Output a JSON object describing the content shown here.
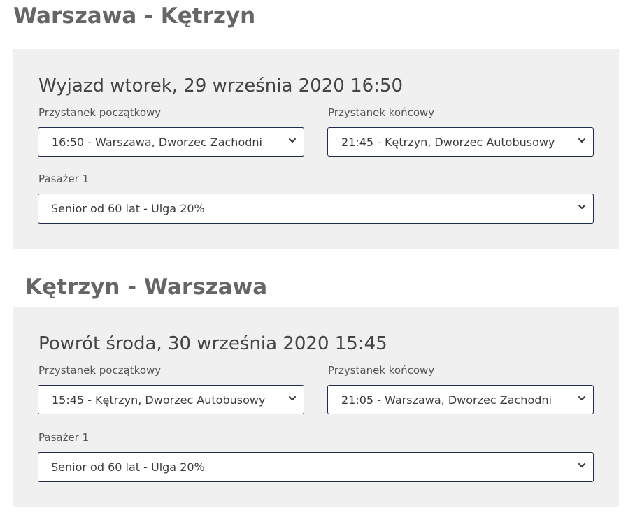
{
  "outbound": {
    "route_title": "Warszawa - Kętrzyn",
    "trip_heading": "Wyjazd wtorek, 29 września 2020 16:50",
    "start_stop": {
      "label": "Przystanek początkowy",
      "selected": "16:50 - Warszawa, Dworzec Zachodni"
    },
    "end_stop": {
      "label": "Przystanek końcowy",
      "selected": "21:45 - Kętrzyn, Dworzec Autobusowy"
    },
    "passenger": {
      "label": "Pasażer 1",
      "selected": "Senior od 60 lat - Ulga 20%"
    }
  },
  "return": {
    "route_title": "Kętrzyn - Warszawa",
    "trip_heading": "Powrót środa, 30 września 2020 15:45",
    "start_stop": {
      "label": "Przystanek początkowy",
      "selected": "15:45 - Kętrzyn, Dworzec Autobusowy"
    },
    "end_stop": {
      "label": "Przystanek końcowy",
      "selected": "21:05 - Warszawa, Dworzec Zachodni"
    },
    "passenger": {
      "label": "Pasażer 1",
      "selected": "Senior od 60 lat - Ulga 20%"
    }
  },
  "icons": {
    "select_arrow": "chevron-down-icon"
  },
  "colors": {
    "panel_background": "#f0f0f0",
    "select_border": "#1f2d4a",
    "route_title": "#666666"
  }
}
